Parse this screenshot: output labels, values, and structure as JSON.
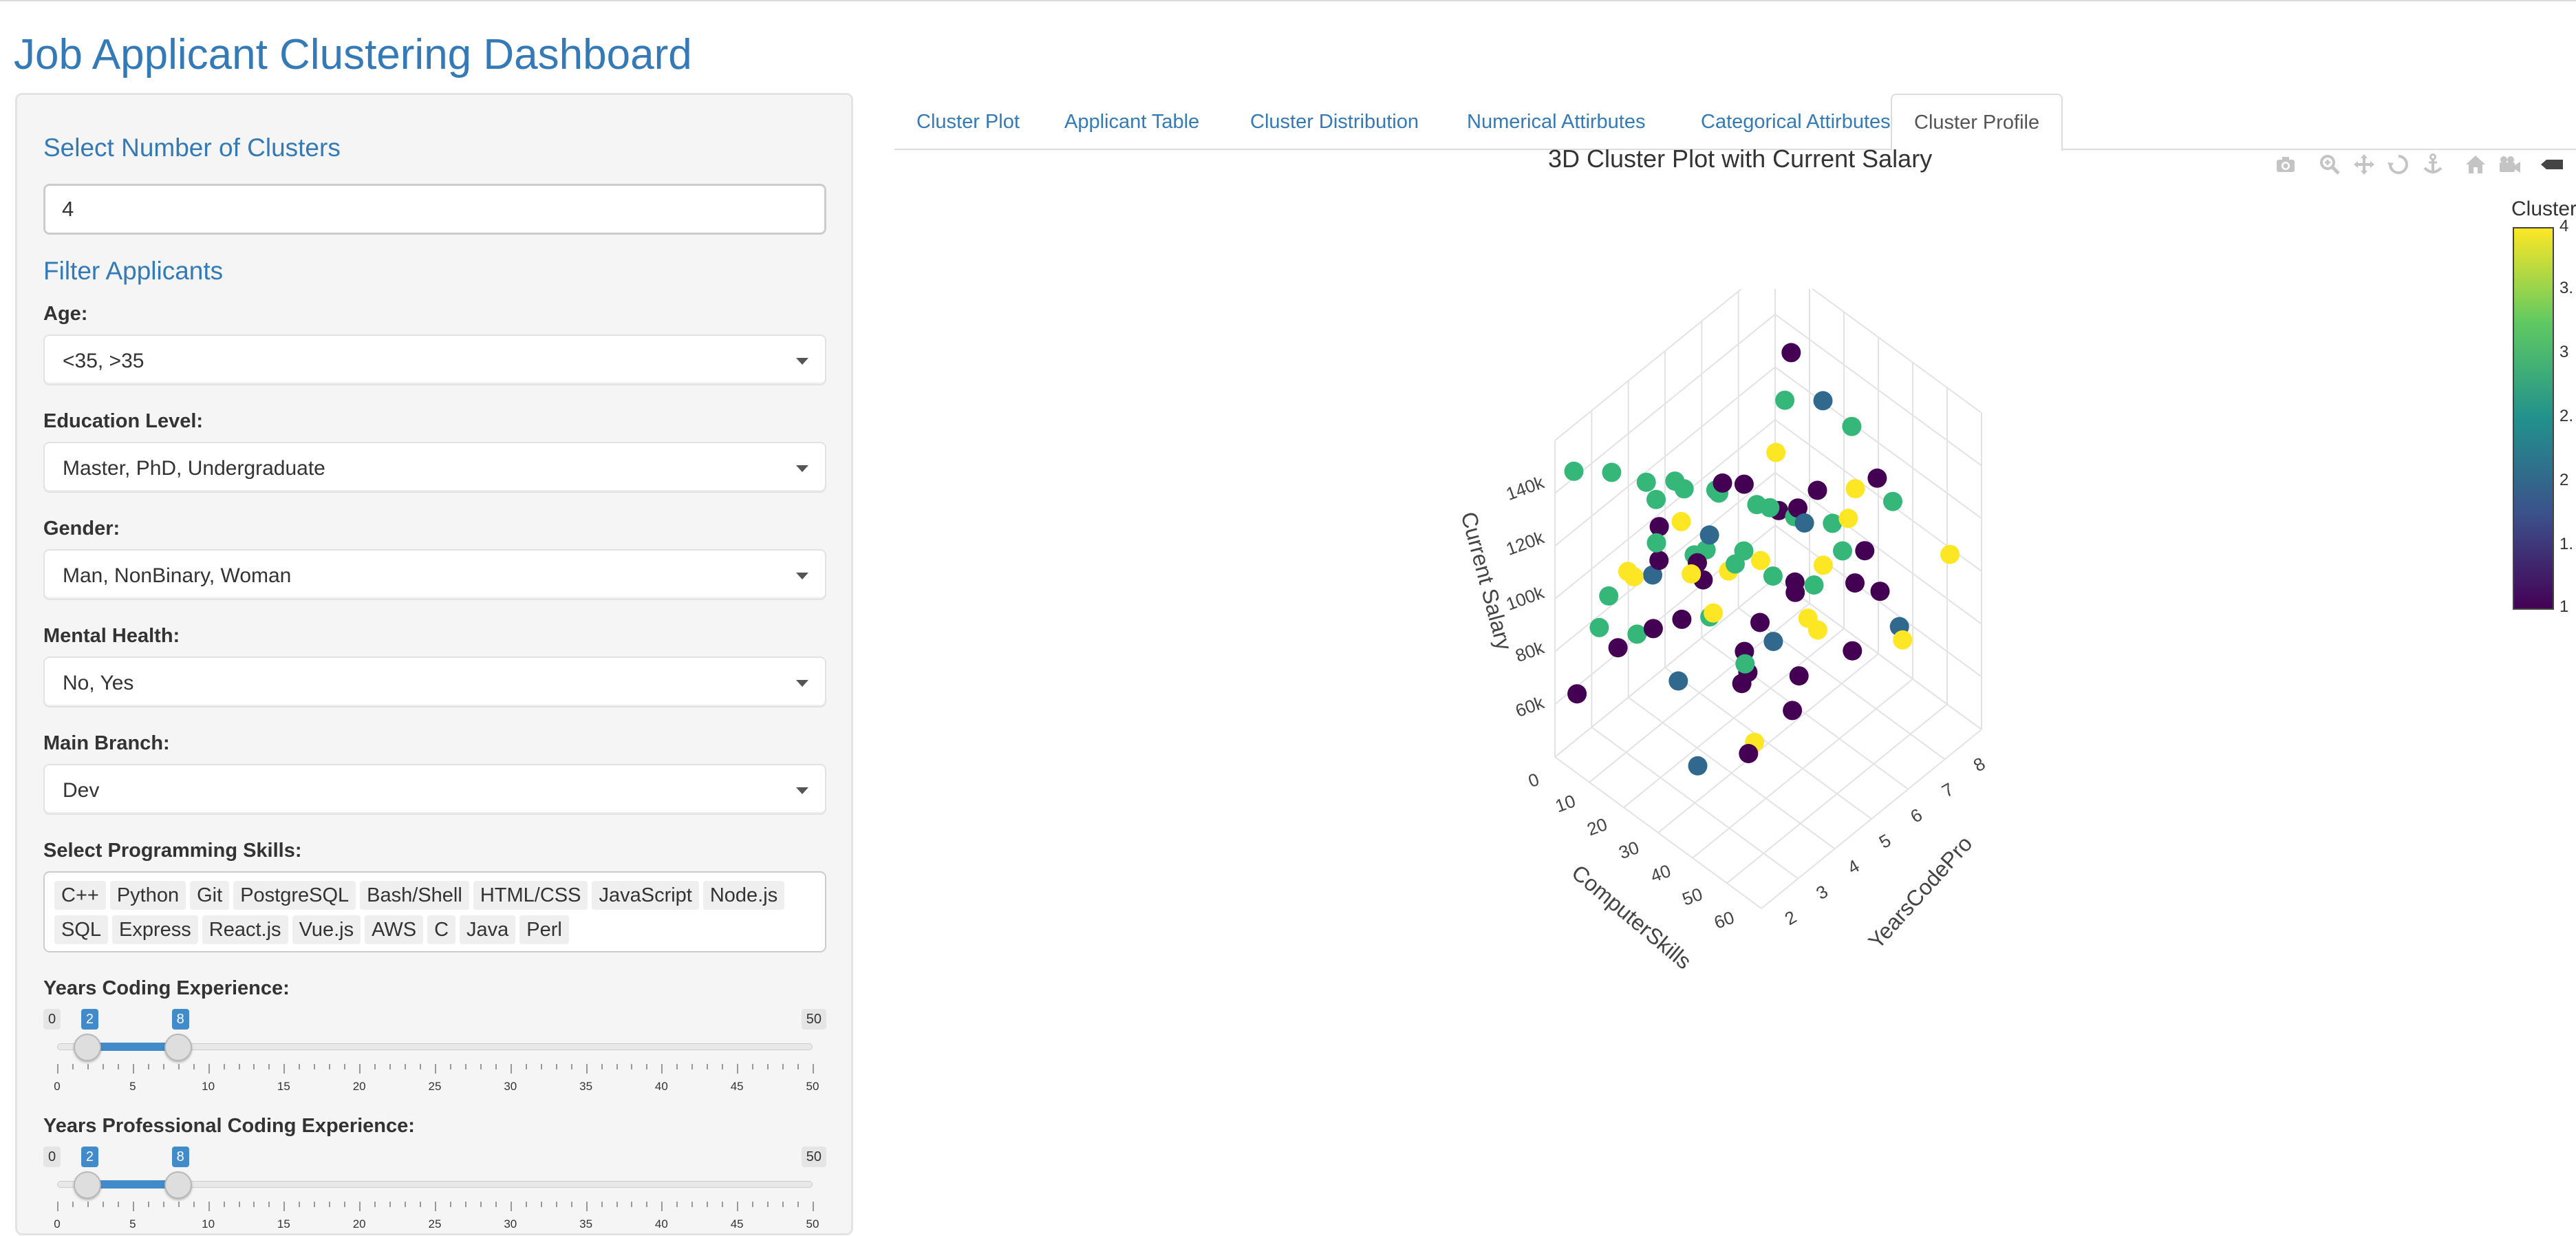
{
  "app": {
    "title": "Job Applicant Clustering Dashboard"
  },
  "sidebar": {
    "clusters_title": "Select Number of Clusters",
    "clusters_value": "4",
    "filter_title": "Filter Applicants",
    "filters": [
      {
        "label": "Age:",
        "value": "<35, >35"
      },
      {
        "label": "Education Level:",
        "value": "Master, PhD, Undergraduate"
      },
      {
        "label": "Gender:",
        "value": "Man, NonBinary, Woman"
      },
      {
        "label": "Mental Health:",
        "value": "No, Yes"
      },
      {
        "label": "Main Branch:",
        "value": "Dev"
      }
    ],
    "skills_label": "Select Programming Skills:",
    "skills": [
      "C++",
      "Python",
      "Git",
      "PostgreSQL",
      "Bash/Shell",
      "HTML/CSS",
      "JavaScript",
      "Node.js",
      "SQL",
      "Express",
      "React.js",
      "Vue.js",
      "AWS",
      "C",
      "Java",
      "Perl"
    ],
    "sliders": [
      {
        "label": "Years Coding Experience:",
        "min": 0,
        "max": 50,
        "from": 2,
        "to": 8,
        "min_label": "0",
        "max_label": "50",
        "from_label": "2",
        "to_label": "8"
      },
      {
        "label": "Years Professional Coding Experience:",
        "min": 0,
        "max": 50,
        "from": 2,
        "to": 8,
        "min_label": "0",
        "max_label": "50",
        "from_label": "2",
        "to_label": "8"
      }
    ],
    "slider_ticks": [
      "0",
      "5",
      "10",
      "15",
      "20",
      "25",
      "30",
      "35",
      "40",
      "45",
      "50"
    ]
  },
  "tabs": [
    {
      "label": "Cluster Plot",
      "active": false
    },
    {
      "label": "Applicant Table",
      "active": false
    },
    {
      "label": "Cluster Distribution",
      "active": false
    },
    {
      "label": "Numerical Attirbutes",
      "active": false
    },
    {
      "label": "Categorical Attirbutes",
      "active": false
    },
    {
      "label": "Cluster Profile",
      "active": true
    }
  ],
  "plot": {
    "title": "3D Cluster Plot with Current Salary",
    "modebar_icons": [
      "camera-icon",
      "zoom-icon",
      "pan-icon",
      "orbit-rotation-icon",
      "turntable-rotation-icon",
      "reset-camera-icon",
      "last-save-camera-icon",
      "toggle-spikelines-icon"
    ],
    "colorbar_title": "Cluster",
    "colorbar_ticks": [
      "4",
      "3.",
      "3",
      "2.",
      "2",
      "1.",
      "1"
    ],
    "colors": {
      "c1": "#440154",
      "c2": "#31688e",
      "c3": "#35b779",
      "c4": "#fde725"
    }
  },
  "chart_data": {
    "type": "scatter",
    "title": "3D Cluster Plot with Current Salary",
    "xlabel": "ComputerSkills",
    "ylabel": "YearsCodePro",
    "zlabel": "Current Salary",
    "x_ticks": [
      "0",
      "10",
      "20",
      "30",
      "40",
      "50",
      "60"
    ],
    "y_ticks": [
      "2",
      "3",
      "4",
      "5",
      "6",
      "7",
      "8"
    ],
    "z_ticks": [
      "60k",
      "80k",
      "100k",
      "120k",
      "140k"
    ],
    "color_by": "Cluster",
    "color_range": [
      1,
      4
    ],
    "series": [
      {
        "name": "1",
        "color": "#440154",
        "points": [
          [
            2,
            2,
            60000
          ],
          [
            5,
            3,
            70000
          ],
          [
            8,
            4,
            95000
          ],
          [
            12,
            5,
            82000
          ],
          [
            15,
            6,
            110000
          ],
          [
            18,
            3,
            125000
          ],
          [
            22,
            7,
            98000
          ],
          [
            25,
            5,
            67000
          ],
          [
            28,
            4,
            140000
          ],
          [
            31,
            6,
            88000
          ],
          [
            35,
            2,
            115000
          ],
          [
            38,
            8,
            72000
          ],
          [
            41,
            5,
            102000
          ],
          [
            44,
            3,
            90000
          ],
          [
            47,
            7,
            130000
          ],
          [
            50,
            4,
            76000
          ],
          [
            53,
            6,
            118000
          ],
          [
            56,
            2,
            84000
          ],
          [
            59,
            5,
            96000
          ],
          [
            62,
            3,
            108000
          ],
          [
            10,
            8,
            135000
          ],
          [
            20,
            6,
            64000
          ],
          [
            30,
            3,
            122000
          ],
          [
            40,
            7,
            86000
          ],
          [
            48,
            5,
            145000
          ],
          [
            36,
            4,
            78000
          ],
          [
            26,
            2,
            104000
          ],
          [
            16,
            7,
            92000
          ]
        ]
      },
      {
        "name": "2",
        "color": "#31688e",
        "points": [
          [
            6,
            4,
            88000
          ],
          [
            14,
            5,
            100000
          ],
          [
            24,
            3,
            74000
          ],
          [
            34,
            6,
            112000
          ],
          [
            44,
            4,
            96000
          ],
          [
            54,
            7,
            82000
          ],
          [
            20,
            8,
            126000
          ],
          [
            40,
            2,
            66000
          ]
        ]
      },
      {
        "name": "3",
        "color": "#35b779",
        "points": [
          [
            1,
            2,
            140000
          ],
          [
            3,
            3,
            132000
          ],
          [
            4,
            4,
            120000
          ],
          [
            6,
            5,
            110000
          ],
          [
            7,
            6,
            100000
          ],
          [
            9,
            2,
            90000
          ],
          [
            11,
            3,
            80000
          ],
          [
            13,
            4,
            128000
          ],
          [
            16,
            5,
            118000
          ],
          [
            19,
            6,
            106000
          ],
          [
            21,
            7,
            94000
          ],
          [
            23,
            8,
            84000
          ],
          [
            27,
            2,
            136000
          ],
          [
            29,
            3,
            124000
          ],
          [
            32,
            4,
            114000
          ],
          [
            34,
            5,
            102000
          ],
          [
            37,
            6,
            92000
          ],
          [
            39,
            7,
            142000
          ],
          [
            42,
            8,
            108000
          ],
          [
            45,
            3,
            98000
          ],
          [
            3,
            6,
            76000
          ],
          [
            5,
            7,
            68000
          ],
          [
            8,
            8,
            116000
          ],
          [
            12,
            2,
            104000
          ],
          [
            17,
            3,
            134000
          ],
          [
            24,
            4,
            88000
          ],
          [
            33,
            5,
            126000
          ],
          [
            46,
            6,
            112000
          ]
        ]
      },
      {
        "name": "4",
        "color": "#fde725",
        "points": [
          [
            10,
            3,
            100000
          ],
          [
            15,
            4,
            115000
          ],
          [
            20,
            5,
            92000
          ],
          [
            25,
            6,
            130000
          ],
          [
            30,
            7,
            84000
          ],
          [
            35,
            3,
            108000
          ],
          [
            40,
            4,
            122000
          ],
          [
            45,
            5,
            96000
          ],
          [
            50,
            6,
            138000
          ],
          [
            55,
            7,
            78000
          ],
          [
            60,
            8,
            104000
          ],
          [
            18,
            2,
            118000
          ],
          [
            28,
            8,
            90000
          ],
          [
            38,
            2,
            134000
          ],
          [
            48,
            3,
            72000
          ],
          [
            58,
            4,
            112000
          ]
        ]
      }
    ]
  }
}
